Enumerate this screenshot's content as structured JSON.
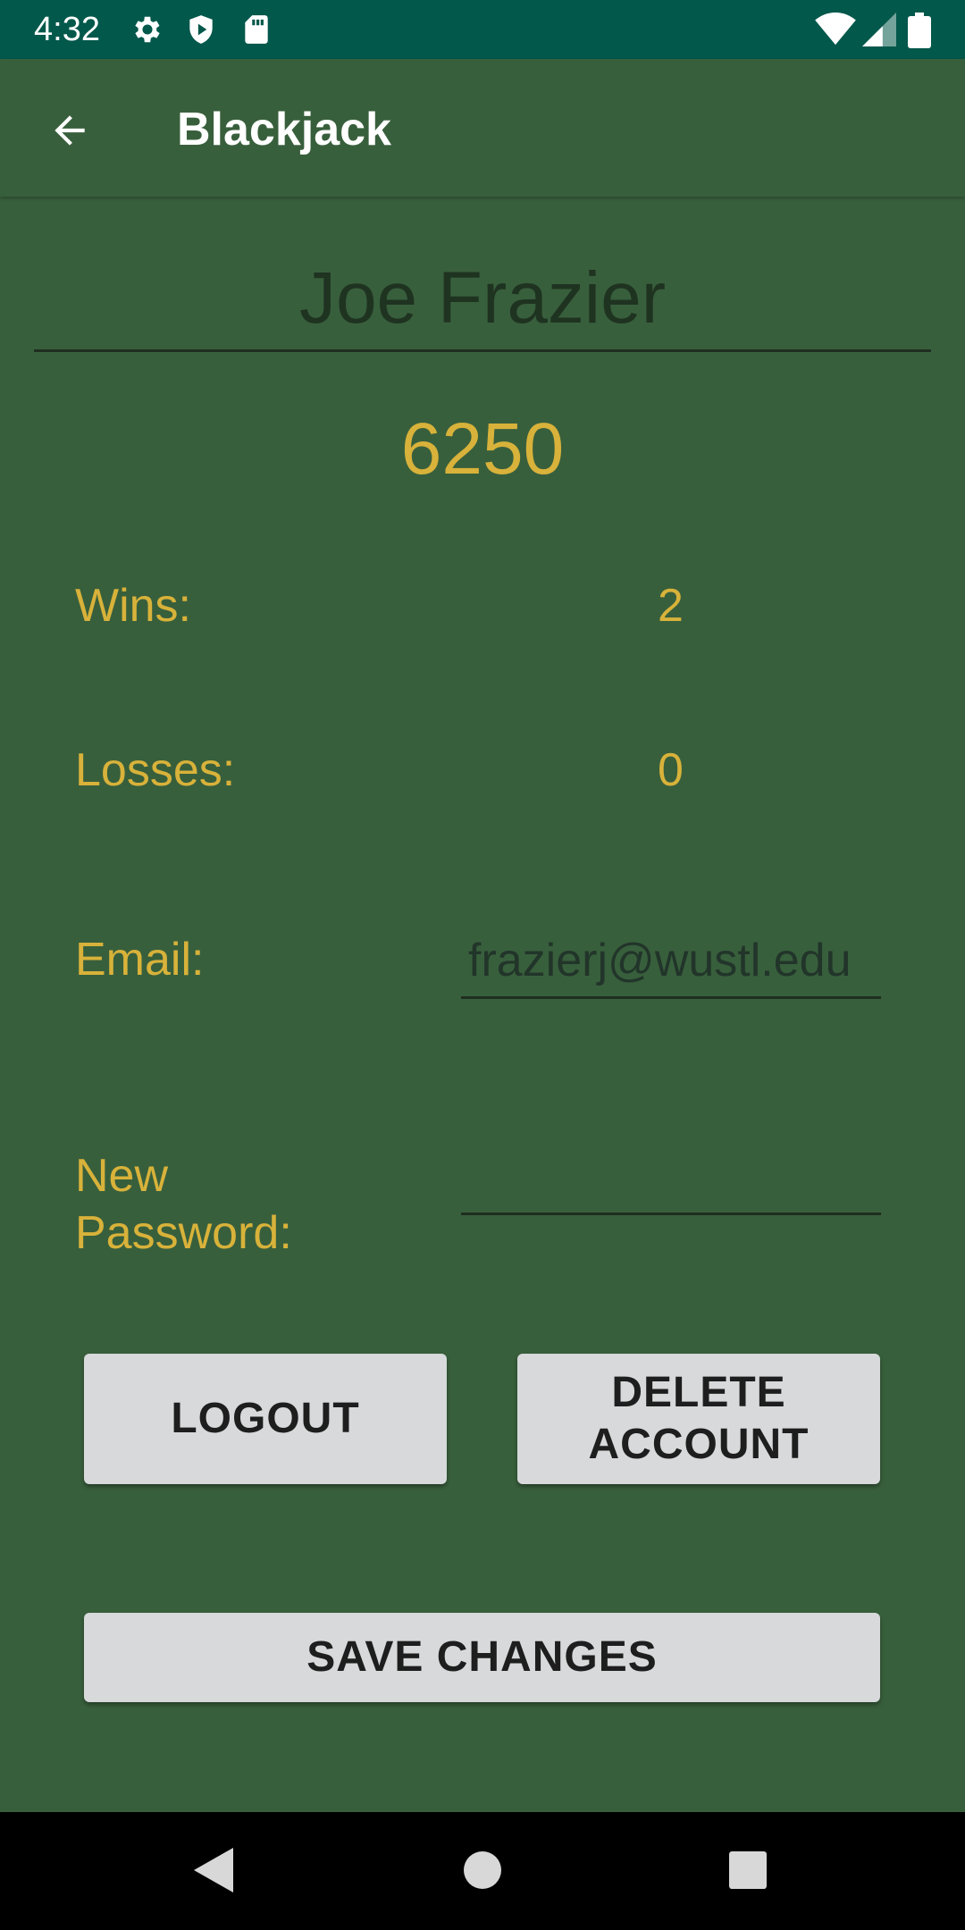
{
  "status_bar": {
    "time": "4:32",
    "icons_left": [
      "gear-icon",
      "shield-icon",
      "sd-card-icon"
    ],
    "icons_right": [
      "wifi-icon",
      "signal-icon",
      "battery-icon"
    ]
  },
  "app_bar": {
    "title": "Blackjack",
    "back_icon": "arrow-back-icon"
  },
  "profile": {
    "name": "Joe Frazier",
    "balance": "6250",
    "wins_label": "Wins:",
    "wins_value": "2",
    "losses_label": "Losses:",
    "losses_value": "0",
    "email_label": "Email:",
    "email_value": "frazierj@wustl.edu",
    "password_label": "New\nPassword:",
    "password_value": ""
  },
  "buttons": {
    "logout": "LOGOUT",
    "delete_account": "DELETE\nACCOUNT",
    "save_changes": "SAVE CHANGES"
  },
  "nav_bar": {
    "icons": [
      "back-triangle-icon",
      "home-circle-icon",
      "recents-square-icon"
    ]
  },
  "colors": {
    "background": "#385f3c",
    "status_bar": "#02584b",
    "accent_text": "#d8b23a",
    "button_bg": "#d7d9da"
  }
}
